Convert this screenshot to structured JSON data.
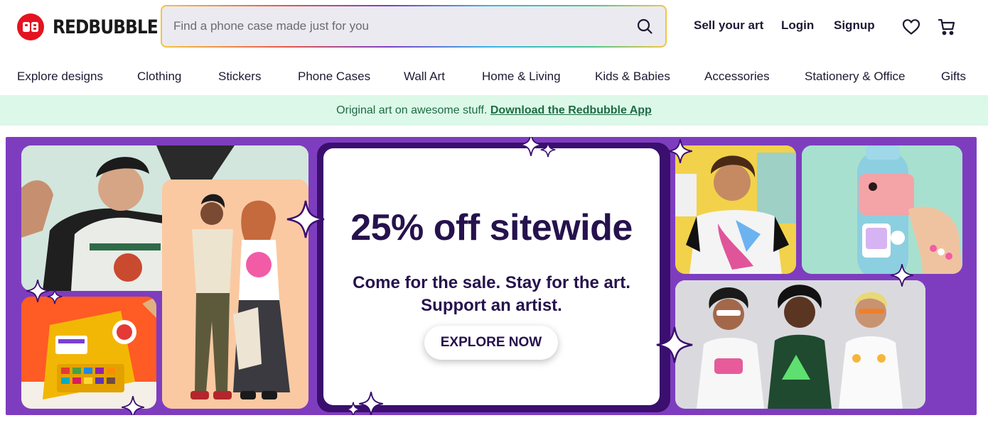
{
  "brand": {
    "name": "REDBUBBLE",
    "logo_glyph": "RB",
    "color": "#e41321"
  },
  "search": {
    "placeholder": "Find a phone case made just for you",
    "value": ""
  },
  "header_links": {
    "sell": "Sell your art",
    "login": "Login",
    "signup": "Signup"
  },
  "icons": {
    "wishlist": "heart-icon",
    "cart": "cart-icon",
    "search": "search-icon"
  },
  "nav": {
    "items": [
      {
        "label": "Explore designs"
      },
      {
        "label": "Clothing"
      },
      {
        "label": "Stickers"
      },
      {
        "label": "Phone Cases"
      },
      {
        "label": "Wall Art"
      },
      {
        "label": "Home & Living"
      },
      {
        "label": "Kids & Babies"
      },
      {
        "label": "Accessories"
      },
      {
        "label": "Stationery & Office"
      },
      {
        "label": "Gifts"
      }
    ]
  },
  "promo": {
    "text": "Original art on awesome stuff.",
    "link": "Download the Redbubble App"
  },
  "banner": {
    "headline": "25% off sitewide",
    "subline": "Come for the sale. Stay for the art. Support an artist.",
    "cta": "EXPLORE NOW",
    "colors": {
      "background": "#7e3dbf",
      "frame": "#3a0f6e",
      "text": "#26124d"
    }
  }
}
